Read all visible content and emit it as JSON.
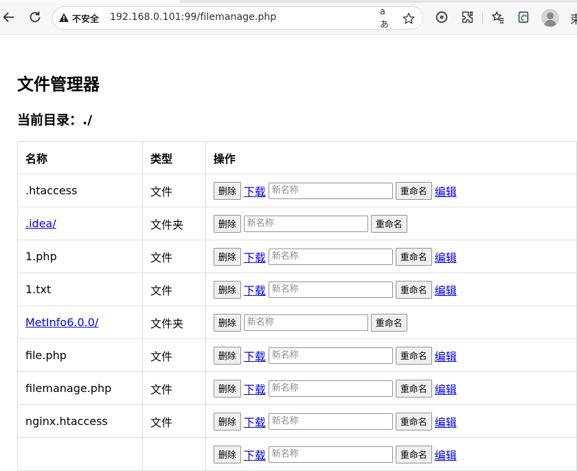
{
  "browser": {
    "security_label": "不安全",
    "url": "192.168.0.101:99/filemanage.php",
    "profile_char": "束"
  },
  "page": {
    "title": "文件管理器",
    "current_dir_label": "当前目录：./"
  },
  "table": {
    "headers": [
      "名称",
      "类型",
      "操作"
    ],
    "rows": [
      {
        "name": ".htaccess",
        "type": "文件",
        "is_dir": false
      },
      {
        "name": ".idea/",
        "type": "文件夹",
        "is_dir": true
      },
      {
        "name": "1.php",
        "type": "文件",
        "is_dir": false
      },
      {
        "name": "1.txt",
        "type": "文件",
        "is_dir": false
      },
      {
        "name": "MetInfo6.0.0/",
        "type": "文件夹",
        "is_dir": true
      },
      {
        "name": "file.php",
        "type": "文件",
        "is_dir": false
      },
      {
        "name": "filemanage.php",
        "type": "文件",
        "is_dir": false
      },
      {
        "name": "nginx.htaccess",
        "type": "文件",
        "is_dir": false
      },
      {
        "name": "",
        "type": "",
        "is_dir": false
      }
    ]
  },
  "actions": {
    "delete_label": "删除",
    "download_label": "下载",
    "rename_placeholder": "新名称",
    "rename_label": "重命名",
    "edit_label": "编辑"
  }
}
